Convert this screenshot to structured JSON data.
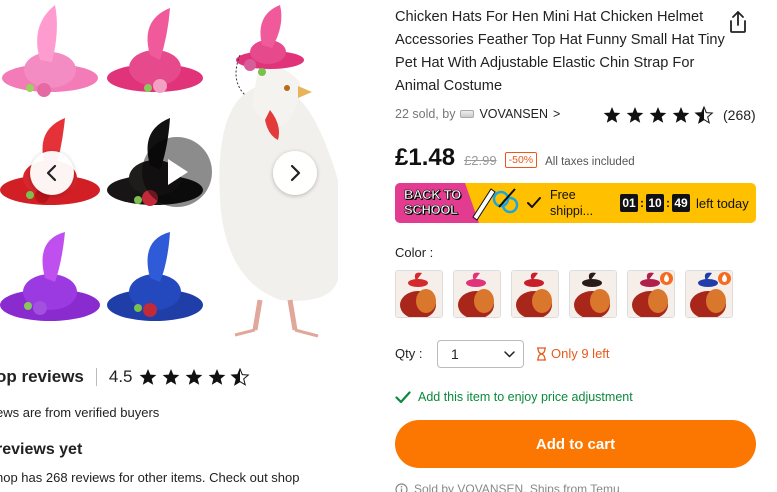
{
  "product": {
    "title": "Chicken Hats For Hen Mini Hat Chicken Helmet Accessories Feather Top Hat Funny Small Hat Tiny Pet Hat With Adjustable Elastic Chin Strap For Animal Costume",
    "sold": "22 sold, by",
    "brand": "VOVANSEN",
    "brand_chevron": ">",
    "rating_value": 4.5,
    "rating_count": "(268)",
    "price": "£1.48",
    "old_price": "£2.99",
    "discount": "-50%",
    "tax_note": "All taxes included"
  },
  "promo": {
    "badge_line1": "BACK TO",
    "badge_line2": "SCHOOL",
    "shipping_text": "Free shippi...",
    "timer_h": "01",
    "timer_m": "10",
    "timer_s": "49",
    "timer_sep": ":",
    "left_today": "left today"
  },
  "options": {
    "color_label": "Color :",
    "swatch_colors": [
      "#d42a2e",
      "#e0337a",
      "#c8202a",
      "#2a1a1a",
      "#b0204c",
      "#1f3ea8"
    ],
    "qty_label": "Qty :",
    "qty_value": "1",
    "stock_note": "Only 9 left"
  },
  "adjust_note": "Add this item to enjoy price adjustment",
  "cart_button": "Add to cart",
  "sold_by_note": "Sold by VOVANSEN, Ships from Temu",
  "shop": {
    "reviews_title": "op reviews",
    "rating": "4.5",
    "verified_note": "ews are from verified buyers",
    "no_reviews": "reviews yet",
    "has_reviews_note": "hop has 268 reviews for other items. Check out shop"
  },
  "colors": {
    "accent_orange": "#fb7701",
    "discount_orange": "#e85a1b",
    "success_green": "#0a8a3b",
    "promo_yellow": "#ffc000",
    "promo_pink": "#e23b8f"
  }
}
